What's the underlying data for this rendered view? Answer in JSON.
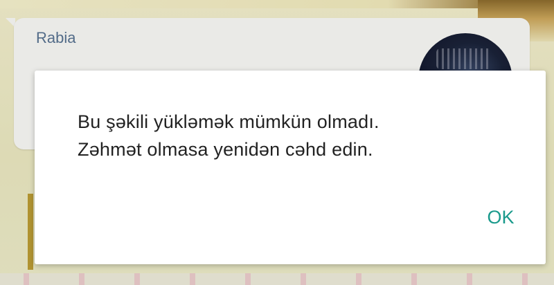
{
  "chat": {
    "sender_name": "Rabia"
  },
  "dialog": {
    "message_line1": "Bu şəkili yükləmək mümkün olmadı.",
    "message_line2": "Zəhmət olmasa yenidən cəhd edin.",
    "ok_label": "OK"
  },
  "colors": {
    "accent": "#1a9a8c",
    "sender_name": "#56708e",
    "wallpaper": "#e9e8c0"
  }
}
